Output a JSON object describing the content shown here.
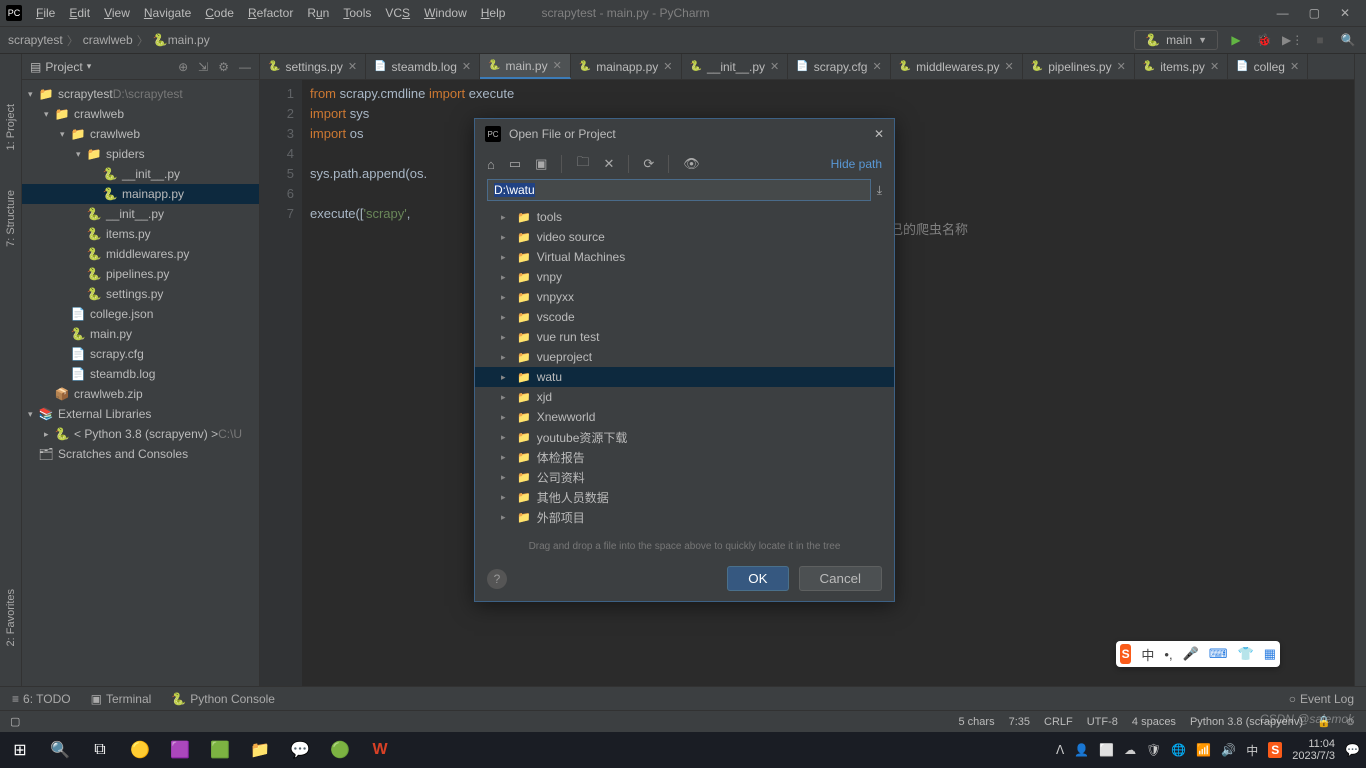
{
  "window": {
    "title": "scrapytest - main.py - PyCharm",
    "menus": [
      "File",
      "Edit",
      "View",
      "Navigate",
      "Code",
      "Refactor",
      "Run",
      "Tools",
      "VCS",
      "Window",
      "Help"
    ]
  },
  "breadcrumb": [
    "scrapytest",
    "crawlweb",
    "main.py"
  ],
  "run_config": "main",
  "sidebar": {
    "title": "Project",
    "tree": [
      {
        "indent": 0,
        "arrow": "open",
        "icon": "📁",
        "label": "scrapytest",
        "extra": "D:\\scrapytest",
        "kind": "folder"
      },
      {
        "indent": 1,
        "arrow": "open",
        "icon": "📁",
        "label": "crawlweb",
        "kind": "folder"
      },
      {
        "indent": 2,
        "arrow": "open",
        "icon": "📁",
        "label": "crawlweb",
        "kind": "folder"
      },
      {
        "indent": 3,
        "arrow": "open",
        "icon": "📁",
        "label": "spiders",
        "kind": "folder"
      },
      {
        "indent": 4,
        "arrow": "blank",
        "icon": "🐍",
        "label": "__init__.py",
        "kind": "py"
      },
      {
        "indent": 4,
        "arrow": "blank",
        "icon": "🐍",
        "label": "mainapp.py",
        "kind": "py",
        "sel": true
      },
      {
        "indent": 3,
        "arrow": "blank",
        "icon": "🐍",
        "label": "__init__.py",
        "kind": "py"
      },
      {
        "indent": 3,
        "arrow": "blank",
        "icon": "🐍",
        "label": "items.py",
        "kind": "py"
      },
      {
        "indent": 3,
        "arrow": "blank",
        "icon": "🐍",
        "label": "middlewares.py",
        "kind": "py"
      },
      {
        "indent": 3,
        "arrow": "blank",
        "icon": "🐍",
        "label": "pipelines.py",
        "kind": "py"
      },
      {
        "indent": 3,
        "arrow": "blank",
        "icon": "🐍",
        "label": "settings.py",
        "kind": "py"
      },
      {
        "indent": 2,
        "arrow": "blank",
        "icon": "📄",
        "label": "college.json",
        "kind": "file"
      },
      {
        "indent": 2,
        "arrow": "blank",
        "icon": "🐍",
        "label": "main.py",
        "kind": "py"
      },
      {
        "indent": 2,
        "arrow": "blank",
        "icon": "📄",
        "label": "scrapy.cfg",
        "kind": "file"
      },
      {
        "indent": 2,
        "arrow": "blank",
        "icon": "📄",
        "label": "steamdb.log",
        "kind": "file"
      },
      {
        "indent": 1,
        "arrow": "blank",
        "icon": "📦",
        "label": "crawlweb.zip",
        "kind": "file"
      },
      {
        "indent": 0,
        "arrow": "open",
        "icon": "📚",
        "label": "External Libraries",
        "kind": "folder"
      },
      {
        "indent": 1,
        "arrow": "closed",
        "icon": "🐍",
        "label": "< Python 3.8 (scrapyenv) >",
        "extra": "C:\\U",
        "kind": "py"
      },
      {
        "indent": 0,
        "arrow": "blank",
        "icon": "🗂",
        "label": "Scratches and Consoles",
        "kind": "file"
      }
    ]
  },
  "left_tools": [
    "1: Project",
    "7: Structure",
    "2: Favorites"
  ],
  "tabs": [
    {
      "label": "settings.py",
      "icon": "🐍"
    },
    {
      "label": "steamdb.log",
      "icon": "📄"
    },
    {
      "label": "main.py",
      "icon": "🐍",
      "active": true
    },
    {
      "label": "mainapp.py",
      "icon": "🐍"
    },
    {
      "label": "__init__.py",
      "icon": "🐍"
    },
    {
      "label": "scrapy.cfg",
      "icon": "📄"
    },
    {
      "label": "middlewares.py",
      "icon": "🐍"
    },
    {
      "label": "pipelines.py",
      "icon": "🐍"
    },
    {
      "label": "items.py",
      "icon": "🐍"
    },
    {
      "label": "colleg",
      "icon": "📄"
    }
  ],
  "code": {
    "lines": [
      "1",
      "2",
      "3",
      "4",
      "5",
      "6",
      "7"
    ],
    "l1_a": "from ",
    "l1_b": "scrapy.cmdline ",
    "l1_c": "import ",
    "l1_d": "execute",
    "l2_a": "import ",
    "l2_b": "sys",
    "l3_a": "import ",
    "l3_b": "os",
    "l5": "sys.path.append(os.",
    "l7_a": "execute([",
    "l7_b": "'scrapy'",
    "l7_c": ","
  },
  "behind_dialog_text": "己的爬虫名称",
  "dialog": {
    "title": "Open File or Project",
    "hidepath": "Hide path",
    "path_value": "D:\\watu",
    "hint": "Drag and drop a file into the space above to quickly locate it in the tree",
    "ok": "OK",
    "cancel": "Cancel",
    "folders": [
      "tools",
      "video source",
      "Virtual Machines",
      "vnpy",
      "vnpyxx",
      "vscode",
      "vue run test",
      "vueproject",
      "watu",
      "xjd",
      "Xnewworld",
      "youtube资源下载",
      "体检报告",
      "公司资料",
      "其他人员数据",
      "外部项目"
    ]
  },
  "bottom_tools": {
    "todo": "6: TODO",
    "terminal": "Terminal",
    "pyconsole": "Python Console",
    "eventlog": "Event Log"
  },
  "status": {
    "chars": "5 chars",
    "pos": "7:35",
    "lineend": "CRLF",
    "enc": "UTF-8",
    "indent": "4 spaces",
    "interp": "Python 3.8 (scrapyenv)"
  },
  "ime": {
    "lang": "中"
  },
  "clock": {
    "time": "11:04",
    "date": "2023/7/3"
  },
  "watermark": "CSDN @salemok"
}
